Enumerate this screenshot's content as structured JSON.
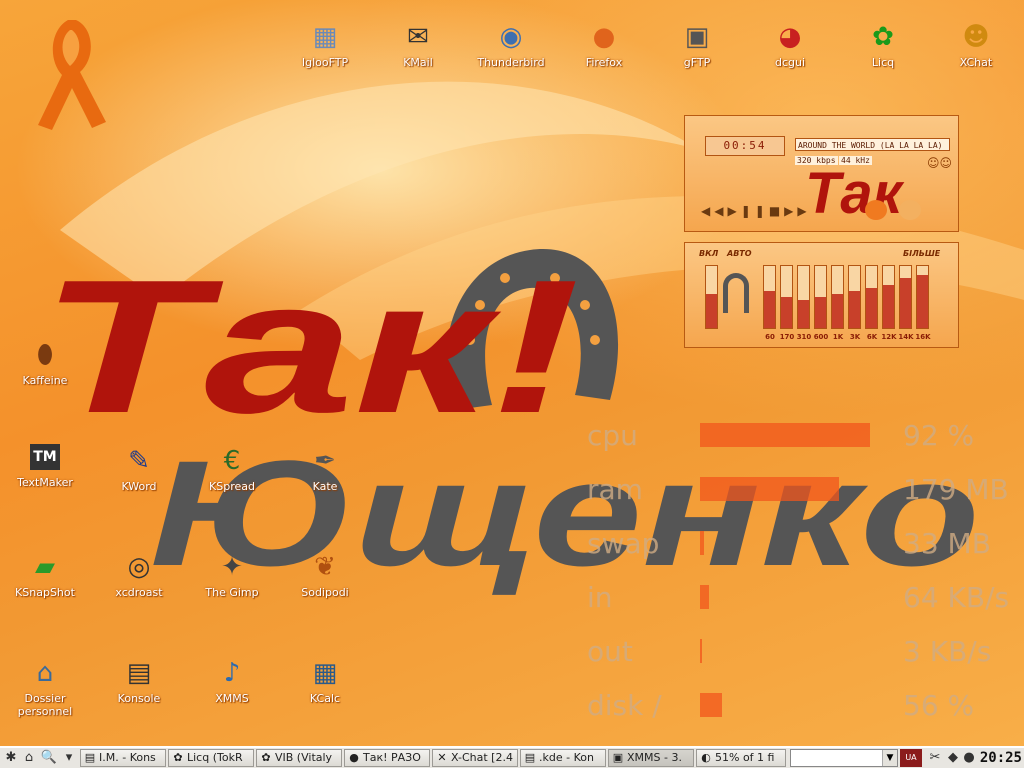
{
  "desktop_icons": [
    {
      "id": "igloo",
      "label": "IglooFTP",
      "icon": "igloo-ftp-icon"
    },
    {
      "id": "kmail",
      "label": "KMail",
      "icon": "kmail-icon"
    },
    {
      "id": "thunderbird",
      "label": "Thunderbird",
      "icon": "thunderbird-icon"
    },
    {
      "id": "firefox",
      "label": "Firefox",
      "icon": "firefox-icon"
    },
    {
      "id": "gftp",
      "label": "gFTP",
      "icon": "gftp-icon"
    },
    {
      "id": "dcgui",
      "label": "dcgui",
      "icon": "dcgui-icon"
    },
    {
      "id": "licq",
      "label": "Licq",
      "icon": "licq-flower-icon"
    },
    {
      "id": "xchat",
      "label": "XChat",
      "icon": "xchat-icon"
    },
    {
      "id": "kaffeine",
      "label": "Kaffeine",
      "icon": "kaffeine-icon"
    },
    {
      "id": "textmaker",
      "label": "TextMaker",
      "icon": "textmaker-icon"
    },
    {
      "id": "kword",
      "label": "KWord",
      "icon": "kword-icon"
    },
    {
      "id": "kspread",
      "label": "KSpread",
      "icon": "kspread-icon"
    },
    {
      "id": "kate",
      "label": "Kate",
      "icon": "kate-icon"
    },
    {
      "id": "ksnapshot",
      "label": "KSnapShot",
      "icon": "ksnapshot-icon"
    },
    {
      "id": "xcdroast",
      "label": "xcdroast",
      "icon": "cd-icon"
    },
    {
      "id": "gimp",
      "label": "The Gimp",
      "icon": "gimp-icon"
    },
    {
      "id": "sodipodi",
      "label": "Sodipodi",
      "icon": "sodipodi-icon"
    },
    {
      "id": "home",
      "label": "Dossier\npersonnel",
      "icon": "home-folder-icon"
    },
    {
      "id": "konsole",
      "label": "Konsole",
      "icon": "konsole-icon"
    },
    {
      "id": "xmms",
      "label": "XMMS",
      "icon": "xmms-icon"
    },
    {
      "id": "kcalc",
      "label": "KCalc",
      "icon": "kcalc-icon"
    }
  ],
  "wallpaper": {
    "line1": "Так!",
    "line2": "Ющенко"
  },
  "xmms": {
    "time": "00:54",
    "title": "AROUND THE WORLD (LA LA LA LA)",
    "bitrate": "320 kbps",
    "samplerate": "44 kHz",
    "skin_logo": "Так",
    "eq_on": "ВКЛ",
    "eq_auto": "АВТО",
    "eq_more": "БІЛЬШЕ",
    "bands": [
      {
        "label": "60",
        "level": 0.6
      },
      {
        "label": "170",
        "level": 0.5
      },
      {
        "label": "310",
        "level": 0.45
      },
      {
        "label": "600",
        "level": 0.5
      },
      {
        "label": "1K",
        "level": 0.55
      },
      {
        "label": "3K",
        "level": 0.6
      },
      {
        "label": "6K",
        "level": 0.65
      },
      {
        "label": "12K",
        "level": 0.7
      },
      {
        "label": "14K",
        "level": 0.8
      },
      {
        "label": "16K",
        "level": 0.85
      }
    ]
  },
  "monitors": [
    {
      "label": "cpu",
      "value": "92 %",
      "level": 0.92
    },
    {
      "label": "ram",
      "value": "179 MB",
      "level": 0.75
    },
    {
      "label": "swap",
      "value": "33 MB",
      "level": 0.02
    },
    {
      "label": "in",
      "value": "64 KB/s",
      "level": 0.05
    },
    {
      "label": "out",
      "value": "3 KB/s",
      "level": 0.01
    },
    {
      "label": "disk /",
      "value": "56 %",
      "level": 0.12
    }
  ],
  "taskbar": {
    "tasks": [
      {
        "label": "I.M. - Kons",
        "icon": "konsole-icon"
      },
      {
        "label": "Licq (TokR",
        "icon": "licq-flower-icon"
      },
      {
        "label": "VIB (Vitaly",
        "icon": "licq-flower-icon"
      },
      {
        "label": "Так! РАЗО",
        "icon": "browser-icon"
      },
      {
        "label": "X-Chat [2.4",
        "icon": "xchat-icon"
      },
      {
        "label": ".kde - Kon",
        "icon": "konsole-icon"
      },
      {
        "label": "XMMS - 3.",
        "icon": "xmms-icon"
      },
      {
        "label": "51% of 1 fi",
        "icon": "download-icon"
      }
    ],
    "clock": "20:25"
  }
}
